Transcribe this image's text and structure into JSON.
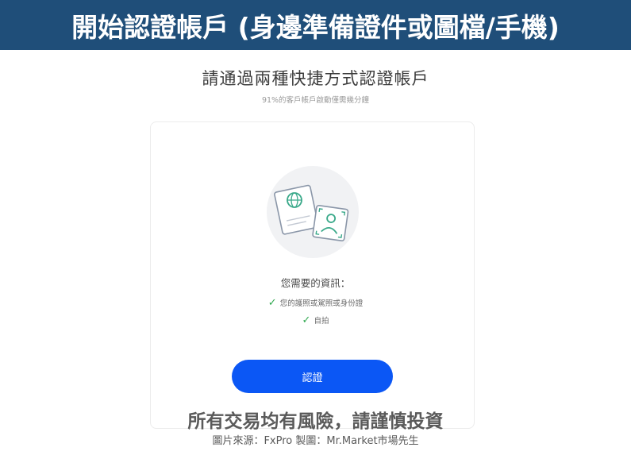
{
  "banner": {
    "title": "開始認證帳戶 (身邊準備證件或圖檔/手機)"
  },
  "main": {
    "heading": "請通過兩種快捷方式認證帳戶",
    "subheading": "91%的客戶帳戶啟動僅需幾分鐘"
  },
  "card": {
    "illustration_icons": [
      "passport-icon",
      "globe-icon",
      "selfie-frame-icon",
      "person-icon"
    ],
    "info_title": "您需要的資訊：",
    "requirements": [
      {
        "icon": "check-icon",
        "label": "您的護照或駕照或身份證"
      },
      {
        "icon": "check-icon",
        "label": "自拍"
      }
    ],
    "verify_button_label": "認證"
  },
  "footer": {
    "risk_warning": "所有交易均有風險，請謹慎投資",
    "credit": "圖片來源：FxPro 製圖：Mr.Market市場先生"
  },
  "colors": {
    "banner_bg": "#1f4e79",
    "button_bg": "#0b57f5",
    "check": "#2fa84f",
    "illustration_accent": "#3aa98a"
  }
}
